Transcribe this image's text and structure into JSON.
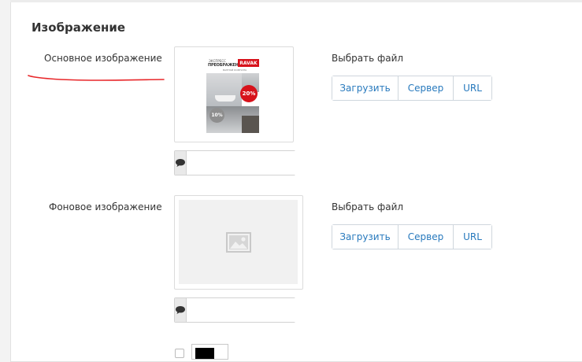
{
  "section": {
    "title": "Изображение"
  },
  "main_image": {
    "label": "Основное изображение",
    "choose_label": "Выбрать файл",
    "buttons": [
      "Загрузить",
      "Сервер",
      "URL"
    ],
    "caption_value": "",
    "preview": {
      "line1": "ЭКСПРЕСС",
      "line2": "ПРЕОБРАЖЕНИЕ",
      "brand": "RAVAK",
      "line3": "ВАННОЙ КОМНАТЫ",
      "badge_big": "20%",
      "badge_small": "10%"
    }
  },
  "background_image": {
    "label": "Фоновое изображение",
    "choose_label": "Выбрать файл",
    "buttons": [
      "Загрузить",
      "Сервер",
      "URL"
    ],
    "caption_value": "",
    "placeholder_icon": "image-placeholder-icon"
  },
  "colors": {
    "accent": "#2779bd",
    "annotation": "#e8272a"
  }
}
